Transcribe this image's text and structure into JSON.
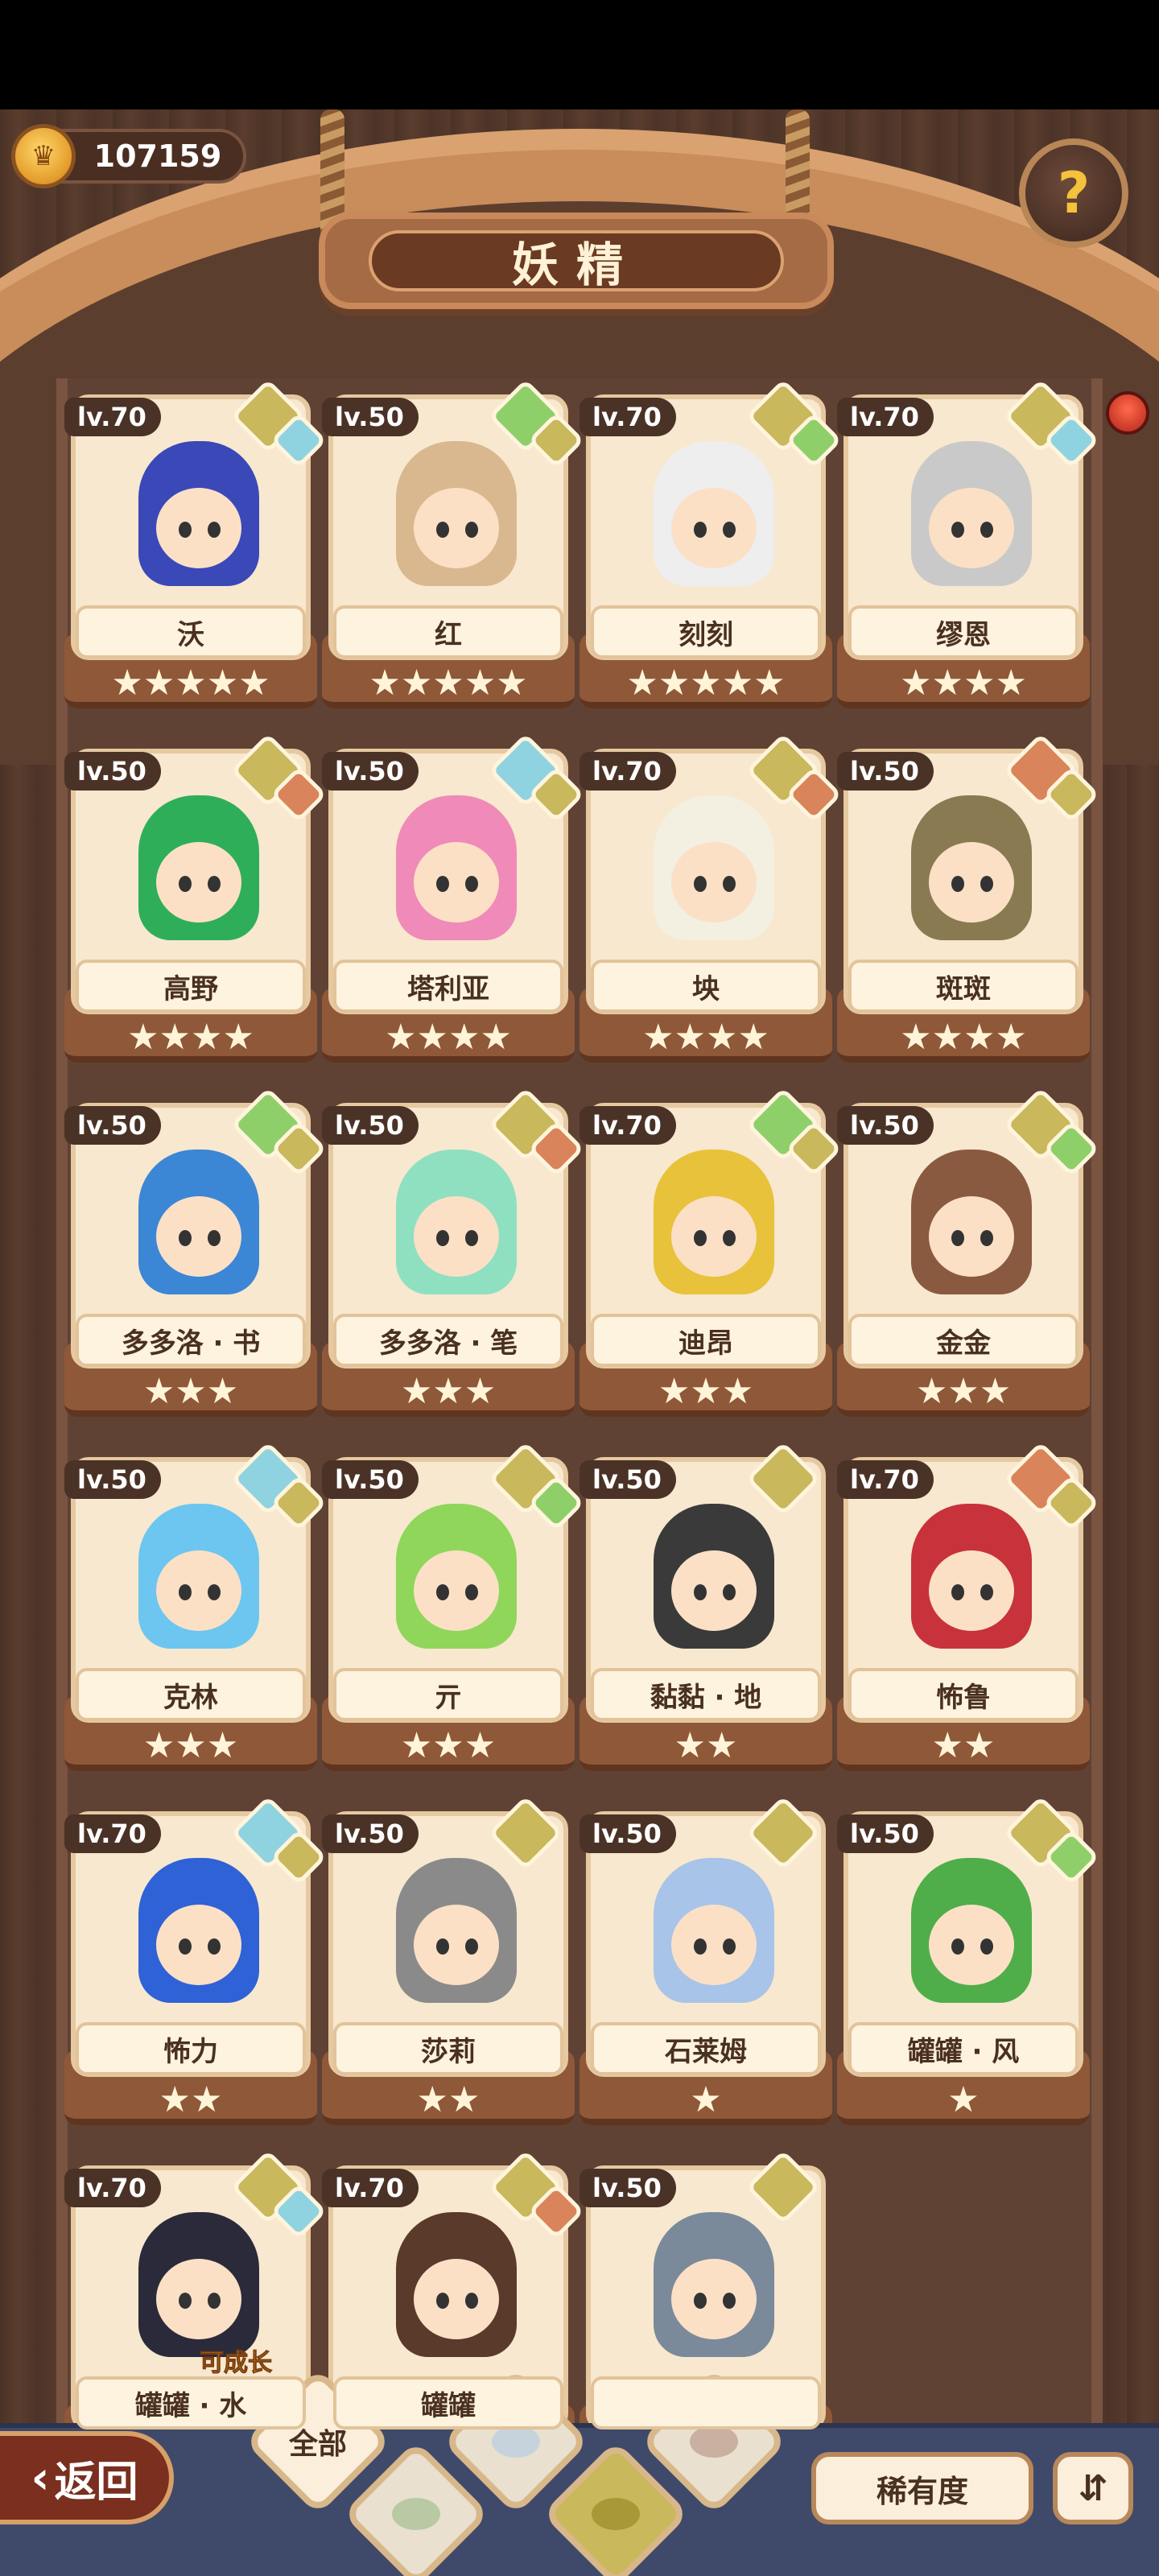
{
  "currency": {
    "value": "107159",
    "icon": "crown-coin-icon"
  },
  "title": "妖精",
  "help_icon": "question-sprout-icon",
  "colors": {
    "earth": "#c9b85c",
    "water": "#8fd3e0",
    "plant": "#8fcf6a",
    "fire": "#d9845a"
  },
  "fairies": [
    {
      "level": "lv.70",
      "name": "沃",
      "stars": "★★★★★",
      "elements": [
        "earth",
        "water"
      ],
      "hair": "#3a48b8"
    },
    {
      "level": "lv.50",
      "name": "红",
      "stars": "★★★★★",
      "elements": [
        "plant",
        "earth"
      ],
      "hair": "#d9b890"
    },
    {
      "level": "lv.70",
      "name": "刻刻",
      "stars": "★★★★★",
      "elements": [
        "earth",
        "plant"
      ],
      "hair": "#eeeeee"
    },
    {
      "level": "lv.70",
      "name": "缪恩",
      "stars": "★★★★",
      "elements": [
        "earth",
        "water"
      ],
      "hair": "#c9c9c9"
    },
    {
      "level": "lv.50",
      "name": "高野",
      "stars": "★★★★",
      "elements": [
        "earth",
        "fire"
      ],
      "hair": "#2fae5a"
    },
    {
      "level": "lv.50",
      "name": "塔利亚",
      "stars": "★★★★",
      "elements": [
        "water",
        "earth"
      ],
      "hair": "#f08ab8"
    },
    {
      "level": "lv.70",
      "name": "坱",
      "stars": "★★★★",
      "elements": [
        "earth",
        "fire"
      ],
      "hair": "#f3f0e2"
    },
    {
      "level": "lv.50",
      "name": "斑斑",
      "stars": "★★★★",
      "elements": [
        "fire",
        "earth"
      ],
      "hair": "#8a7a52"
    },
    {
      "level": "lv.50",
      "name": "多多洛 · 书",
      "stars": "★★★",
      "elements": [
        "plant",
        "earth"
      ],
      "hair": "#3c86d6"
    },
    {
      "level": "lv.50",
      "name": "多多洛 · 笔",
      "stars": "★★★",
      "elements": [
        "earth",
        "fire"
      ],
      "hair": "#8fe0c0"
    },
    {
      "level": "lv.70",
      "name": "迪昂",
      "stars": "★★★",
      "elements": [
        "plant",
        "earth"
      ],
      "hair": "#e8c23a"
    },
    {
      "level": "lv.50",
      "name": "金金",
      "stars": "★★★",
      "elements": [
        "earth",
        "plant"
      ],
      "hair": "#8a5a40"
    },
    {
      "level": "lv.50",
      "name": "克林",
      "stars": "★★★",
      "elements": [
        "water",
        "earth"
      ],
      "hair": "#6cc6ef"
    },
    {
      "level": "lv.50",
      "name": "亓",
      "stars": "★★★",
      "elements": [
        "earth",
        "plant"
      ],
      "hair": "#8fd65a"
    },
    {
      "level": "lv.50",
      "name": "黏黏 · 地",
      "stars": "★★",
      "elements": [
        "earth"
      ],
      "hair": "#3a3a3a"
    },
    {
      "level": "lv.70",
      "name": "怖鲁",
      "stars": "★★",
      "elements": [
        "fire",
        "earth"
      ],
      "hair": "#c8323a"
    },
    {
      "level": "lv.70",
      "name": "怖力",
      "stars": "★★",
      "elements": [
        "water",
        "earth"
      ],
      "hair": "#2f62d6"
    },
    {
      "level": "lv.50",
      "name": "莎莉",
      "stars": "★★",
      "elements": [
        "earth"
      ],
      "hair": "#8a8a8a"
    },
    {
      "level": "lv.50",
      "name": "石莱姆",
      "stars": "★",
      "elements": [
        "earth"
      ],
      "hair": "#a8c4e8"
    },
    {
      "level": "lv.50",
      "name": "罐罐 · 风",
      "stars": "★",
      "elements": [
        "earth",
        "plant"
      ],
      "hair": "#4fae4a"
    },
    {
      "level": "lv.70",
      "name": "罐罐 · 水",
      "stars": "",
      "elements": [
        "earth",
        "water"
      ],
      "hair": "#2a2a3a",
      "tag": "可成长"
    },
    {
      "level": "lv.70",
      "name": "罐罐",
      "stars": "",
      "elements": [
        "earth",
        "fire"
      ],
      "hair": "#5a3a2a"
    },
    {
      "level": "lv.50",
      "name": "",
      "stars": "",
      "elements": [
        "earth"
      ],
      "hair": "#7a8a9a"
    }
  ],
  "bottom": {
    "back_label": "返回",
    "filters": [
      {
        "label": "全部",
        "icon": "all-filter-icon"
      },
      {
        "label": "",
        "icon": "plant-filter-icon"
      },
      {
        "label": "",
        "icon": "water-filter-icon"
      },
      {
        "label": "",
        "icon": "earth-filter-icon"
      },
      {
        "label": "",
        "icon": "fire-filter-icon"
      }
    ],
    "rarity_label": "稀有度",
    "sort_icon": "sort-icon"
  }
}
